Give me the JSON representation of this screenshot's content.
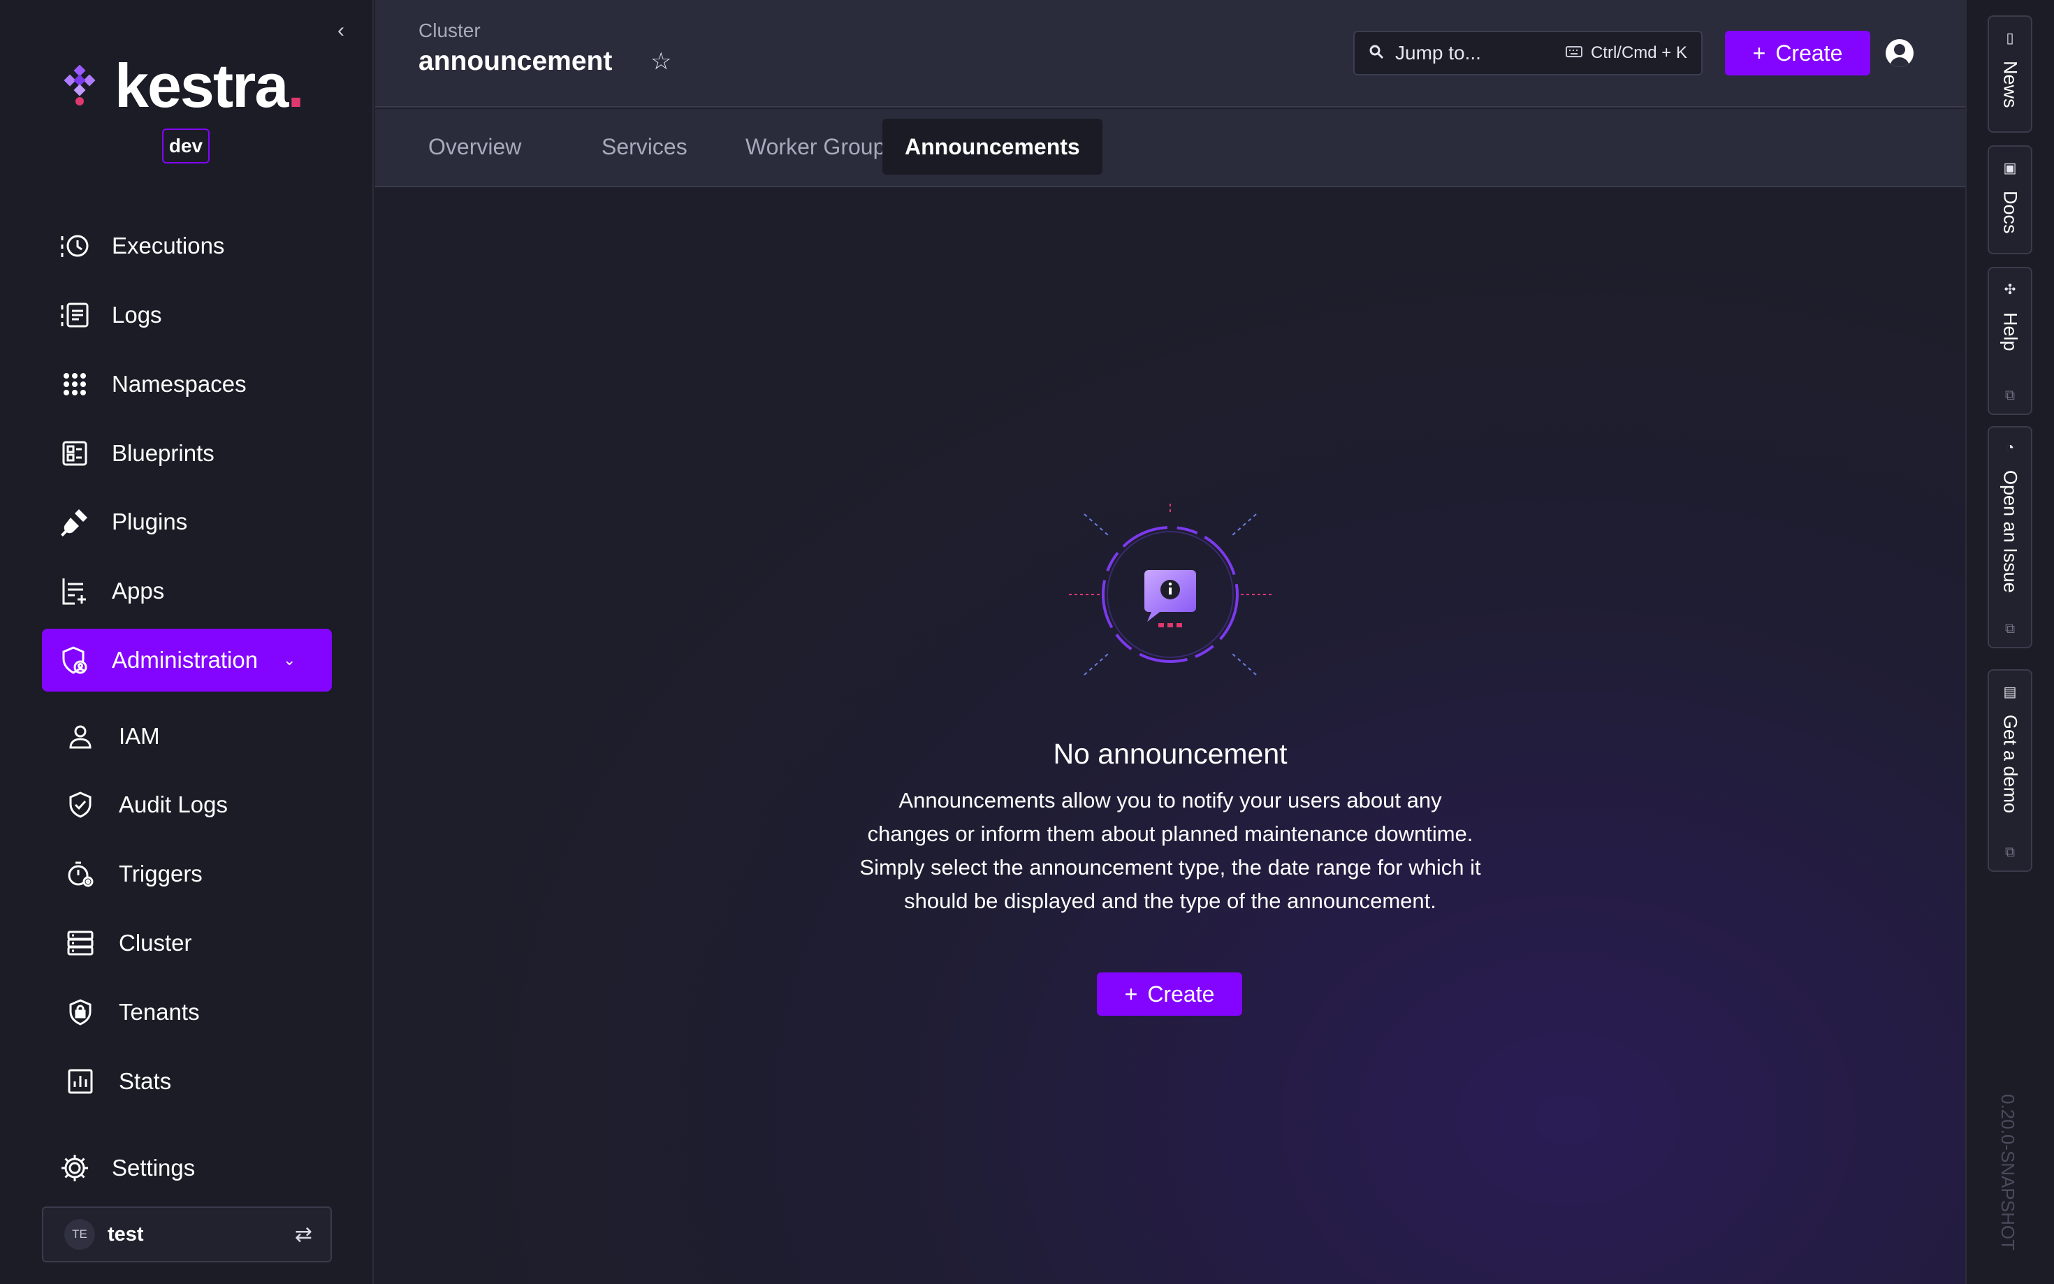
{
  "brand": {
    "name": "kestra",
    "dot": ".",
    "env": "dev"
  },
  "sidebar": {
    "items": [
      {
        "label": "Executions"
      },
      {
        "label": "Logs"
      },
      {
        "label": "Namespaces"
      },
      {
        "label": "Blueprints"
      },
      {
        "label": "Plugins"
      },
      {
        "label": "Apps"
      },
      {
        "label": "Administration"
      }
    ],
    "admin_items": [
      {
        "label": "IAM"
      },
      {
        "label": "Audit Logs"
      },
      {
        "label": "Triggers"
      },
      {
        "label": "Cluster"
      },
      {
        "label": "Tenants"
      },
      {
        "label": "Stats"
      }
    ],
    "settings": "Settings",
    "tenant": {
      "initials": "TE",
      "name": "test"
    }
  },
  "header": {
    "category": "Cluster",
    "title": "announcement",
    "search_placeholder": "Jump to...",
    "shortcut": "Ctrl/Cmd + K",
    "create_label": "Create"
  },
  "tabs": [
    {
      "label": "Overview"
    },
    {
      "label": "Services"
    },
    {
      "label": "Worker Groups"
    },
    {
      "label": "Announcements"
    }
  ],
  "empty_state": {
    "title": "No announcement",
    "description": "Announcements allow you to notify your users about any changes or inform them about planned maintenance downtime. Simply select the announcement type, the date range for which it should be displayed and the type of the announcement.",
    "create_label": "Create"
  },
  "rail": {
    "items": [
      {
        "label": "News"
      },
      {
        "label": "Docs"
      },
      {
        "label": "Help"
      },
      {
        "label": "Open an Issue"
      },
      {
        "label": "Get a demo"
      }
    ],
    "version": "0.20.0-SNAPSHOT"
  },
  "colors": {
    "accent": "#8405ff",
    "brand_dot": "#e0386e"
  }
}
